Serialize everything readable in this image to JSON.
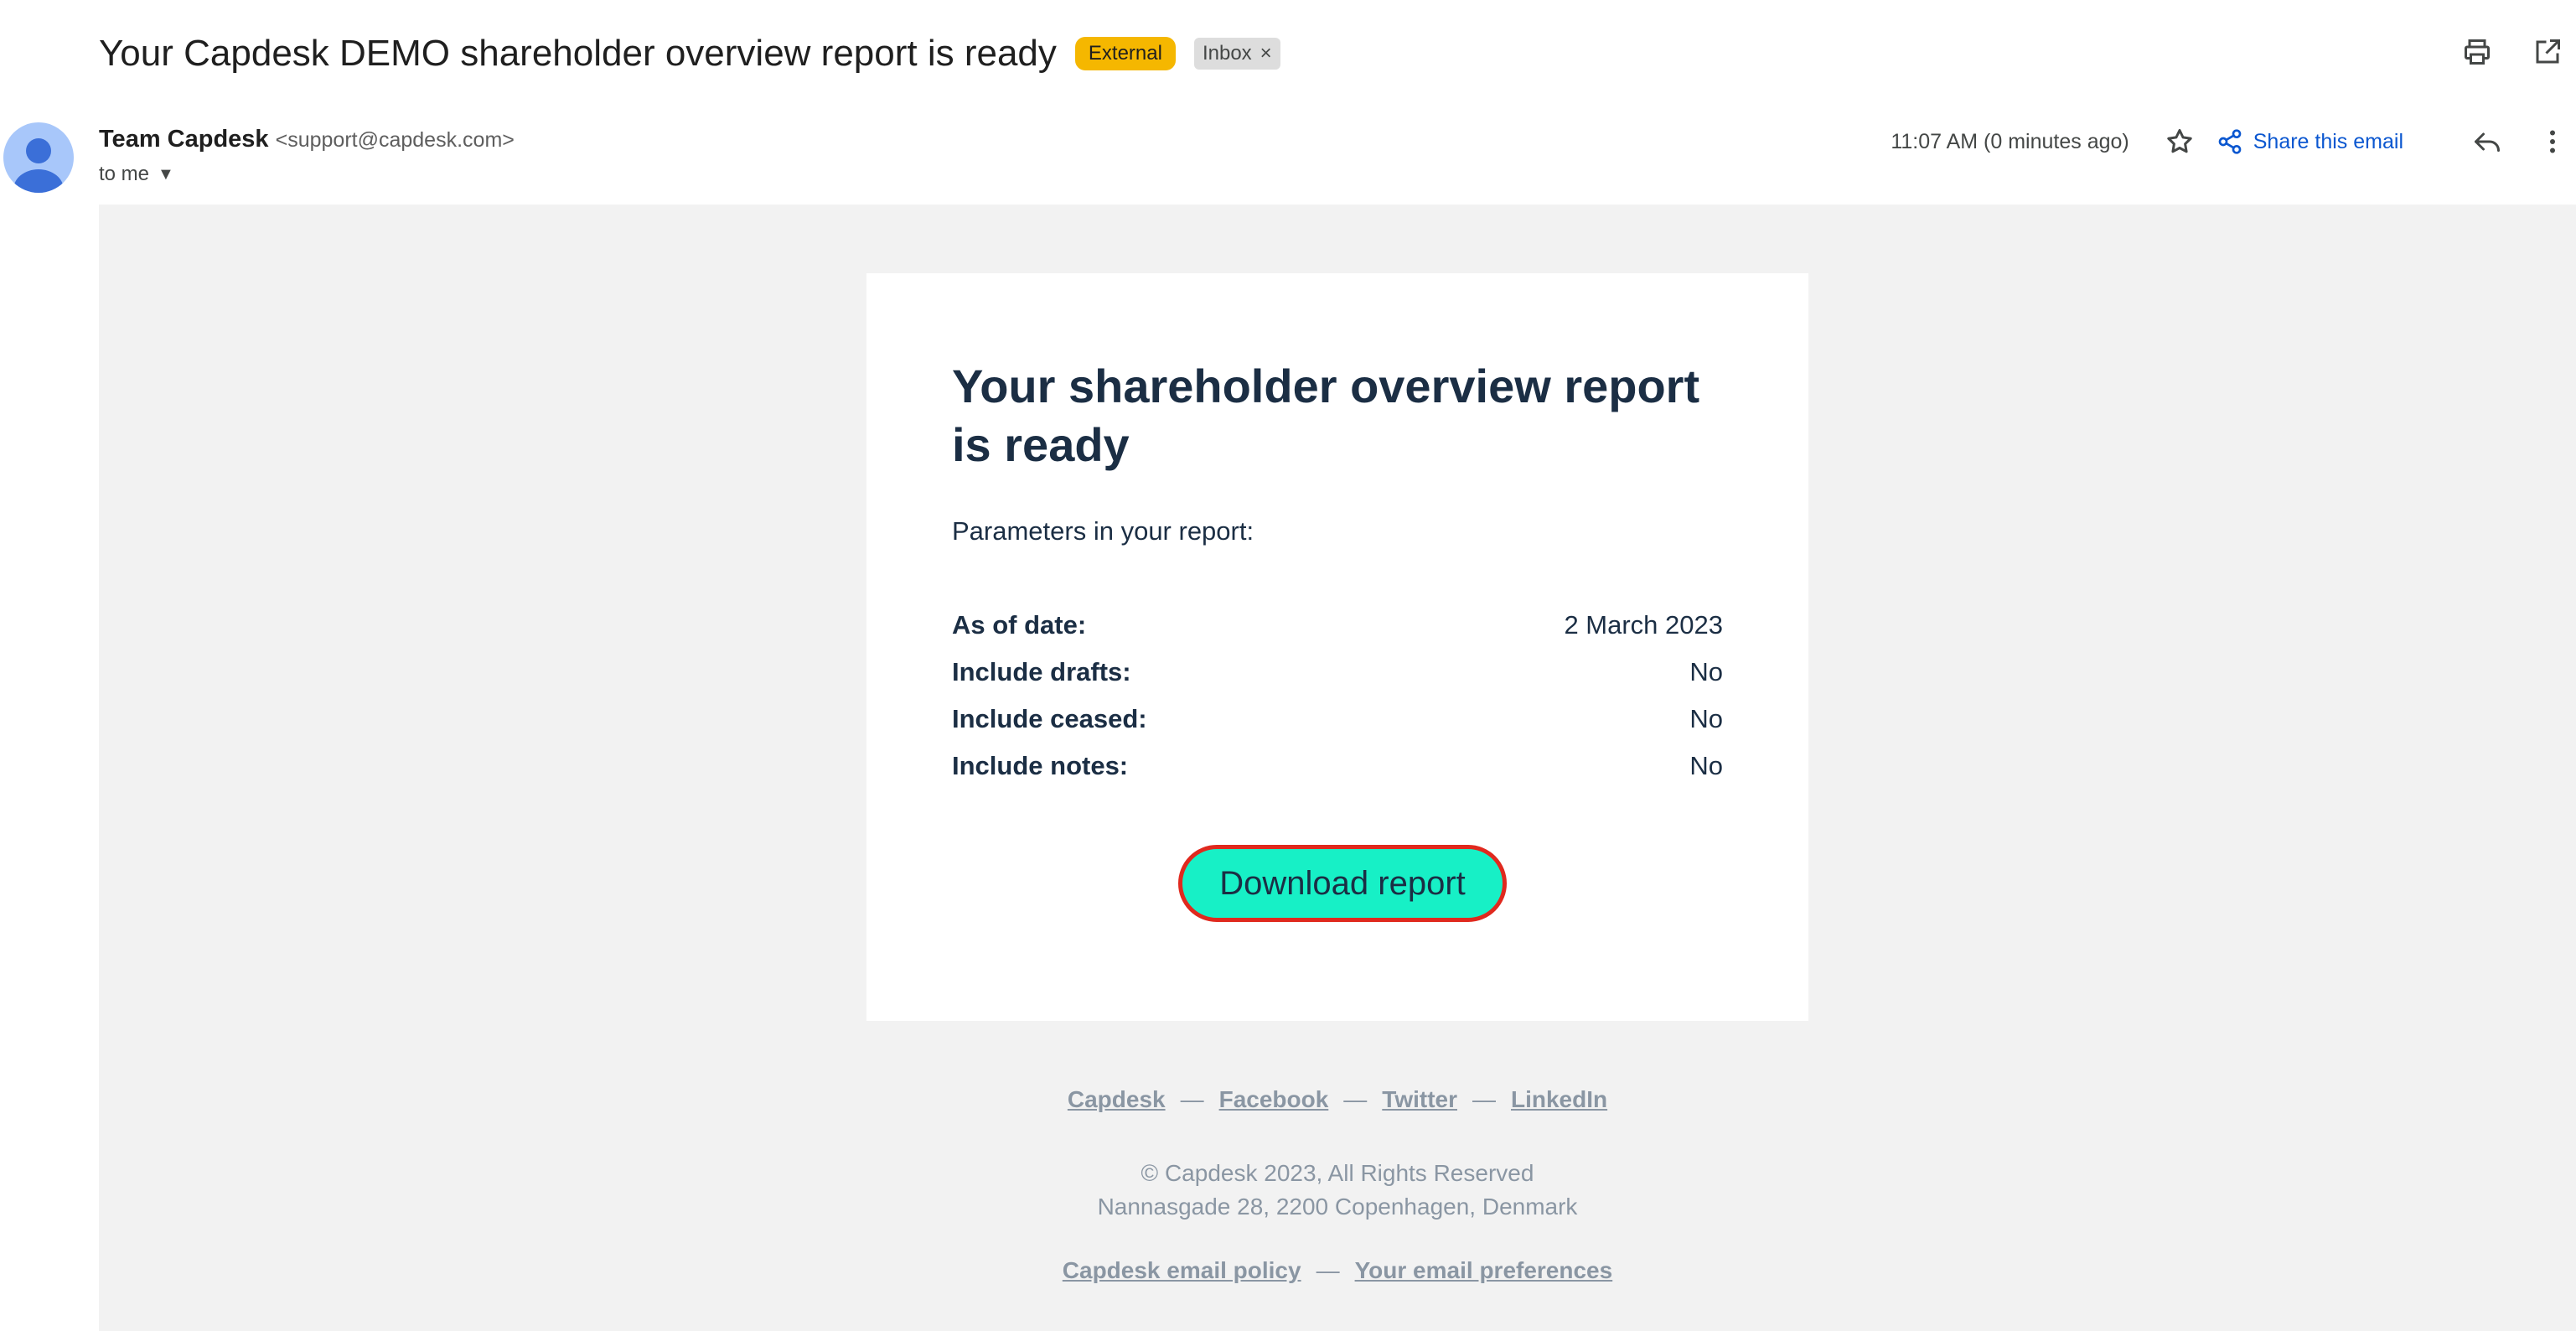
{
  "header": {
    "subject": "Your Capdesk DEMO shareholder overview report is ready",
    "labels": {
      "external": "External",
      "inbox": "Inbox",
      "inbox_remove": "×"
    },
    "icons": [
      "print-icon",
      "open-in-new-window-icon"
    ]
  },
  "sender": {
    "name": "Team Capdesk",
    "email": "<support@capdesk.com>",
    "to": "to me",
    "timestamp": "11:07 AM (0 minutes ago)",
    "share_label": "Share this email"
  },
  "email": {
    "title": "Your shareholder overview report is ready",
    "params_intro": "Parameters in your report:",
    "params": [
      {
        "key": "As of date:",
        "value": "2 March 2023"
      },
      {
        "key": "Include drafts:",
        "value": "No"
      },
      {
        "key": "Include ceased:",
        "value": "No"
      },
      {
        "key": "Include notes:",
        "value": "No"
      }
    ],
    "download_label": "Download report"
  },
  "footer": {
    "links": [
      "Capdesk",
      "Facebook",
      "Twitter",
      "LinkedIn"
    ],
    "separator": "—",
    "copyright": "© Capdesk 2023, All Rights Reserved",
    "address": "Nannasgade 28, 2200 Copenhagen, Denmark",
    "policy_links": [
      "Capdesk email policy",
      "Your email preferences"
    ]
  },
  "colors": {
    "accent_button": "#17f0c6",
    "button_highlight_border": "#e0291e",
    "external_label": "#f5b700",
    "share_link": "#0b57d0",
    "heading_text": "#1b2e44",
    "body_background": "#f2f2f2"
  }
}
